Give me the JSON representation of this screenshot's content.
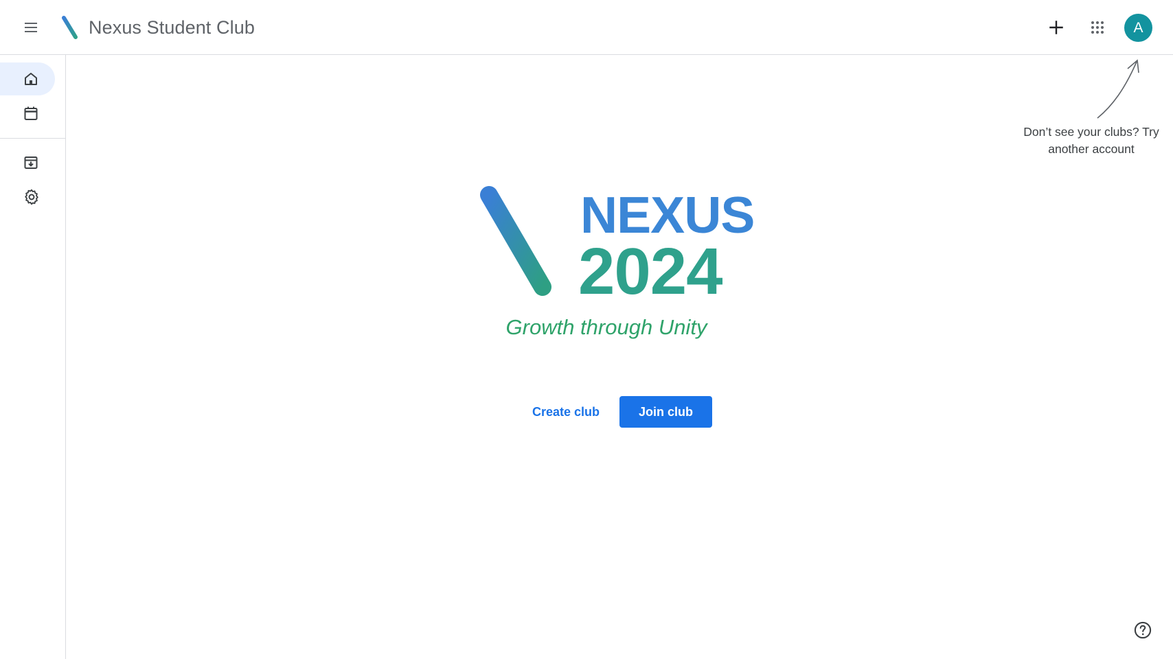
{
  "header": {
    "title": "Nexus Student Club",
    "avatar_initial": "A",
    "icons": {
      "menu": "menu-icon",
      "logo": "nexus-logo",
      "add": "add-icon",
      "apps": "apps-grid-icon",
      "help": "help-icon"
    }
  },
  "sidebar": {
    "items": [
      {
        "name": "home",
        "icon": "home-icon",
        "active": true
      },
      {
        "name": "calendar",
        "icon": "calendar-icon",
        "active": false
      },
      {
        "name": "archived",
        "icon": "archive-icon",
        "active": false
      },
      {
        "name": "settings",
        "icon": "settings-icon",
        "active": false
      }
    ]
  },
  "hint": {
    "text": "Don’t see your clubs? Try another account"
  },
  "hero": {
    "line1": "NEXUS",
    "line2": "2024",
    "tagline": "Growth through Unity"
  },
  "actions": {
    "create_label": "Create club",
    "join_label": "Join club"
  },
  "colors": {
    "accent": "#1a73e8",
    "avatar": "#13939f",
    "nexus_blue": "#3b86d6",
    "year_green": "#2fa18c",
    "tagline_green": "#2fa36a",
    "active_nav": "#e8f0fe"
  }
}
